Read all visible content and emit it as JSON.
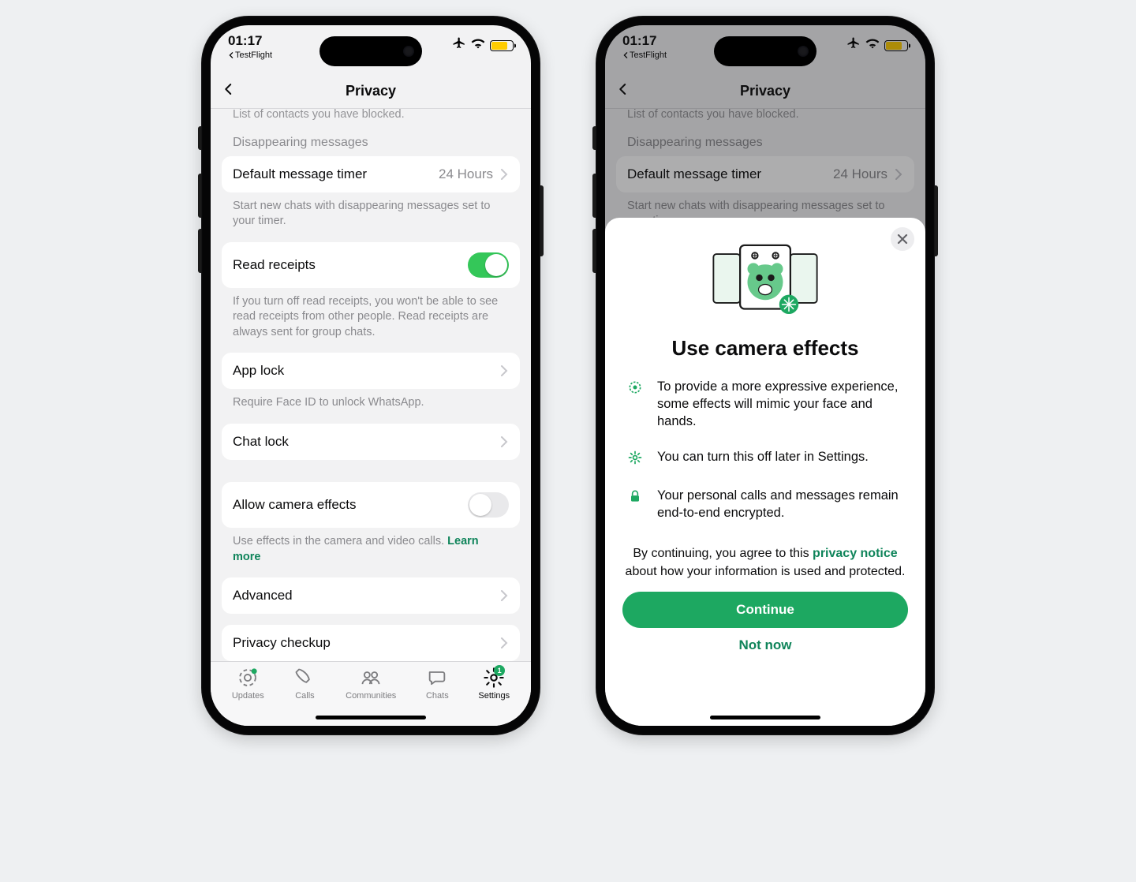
{
  "status": {
    "time": "01:17",
    "back_app": "TestFlight"
  },
  "nav": {
    "title": "Privacy"
  },
  "truncated_line": "List of contacts you have blocked.",
  "disappearing": {
    "section": "Disappearing messages",
    "row_label": "Default message timer",
    "row_value": "24 Hours",
    "footer": "Start new chats with disappearing messages set to your timer."
  },
  "read_receipts": {
    "label": "Read receipts",
    "on": true,
    "footer": "If you turn off read receipts, you won't be able to see read receipts from other people. Read receipts are always sent for group chats."
  },
  "app_lock": {
    "label": "App lock",
    "footer": "Require Face ID to unlock WhatsApp."
  },
  "chat_lock": {
    "label": "Chat lock"
  },
  "camera_effects": {
    "label": "Allow camera effects",
    "on": false,
    "footer": "Use effects in the camera and video calls. ",
    "learn_more": "Learn more"
  },
  "advanced": {
    "label": "Advanced"
  },
  "privacy_checkup": {
    "label": "Privacy checkup"
  },
  "tabs": {
    "updates": "Updates",
    "calls": "Calls",
    "communities": "Communities",
    "chats": "Chats",
    "settings": "Settings",
    "settings_badge": "1"
  },
  "sheet": {
    "title": "Use camera effects",
    "bullet1": "To provide a more expressive experience, some effects will mimic your face and hands.",
    "bullet2": "You can turn this off later in Settings.",
    "bullet3": "Your personal calls and messages remain end-to-end encrypted.",
    "legal_pre": "By continuing, you agree to this ",
    "legal_link": "privacy notice",
    "legal_post": " about how your information is used and protected.",
    "continue": "Continue",
    "not_now": "Not now"
  }
}
